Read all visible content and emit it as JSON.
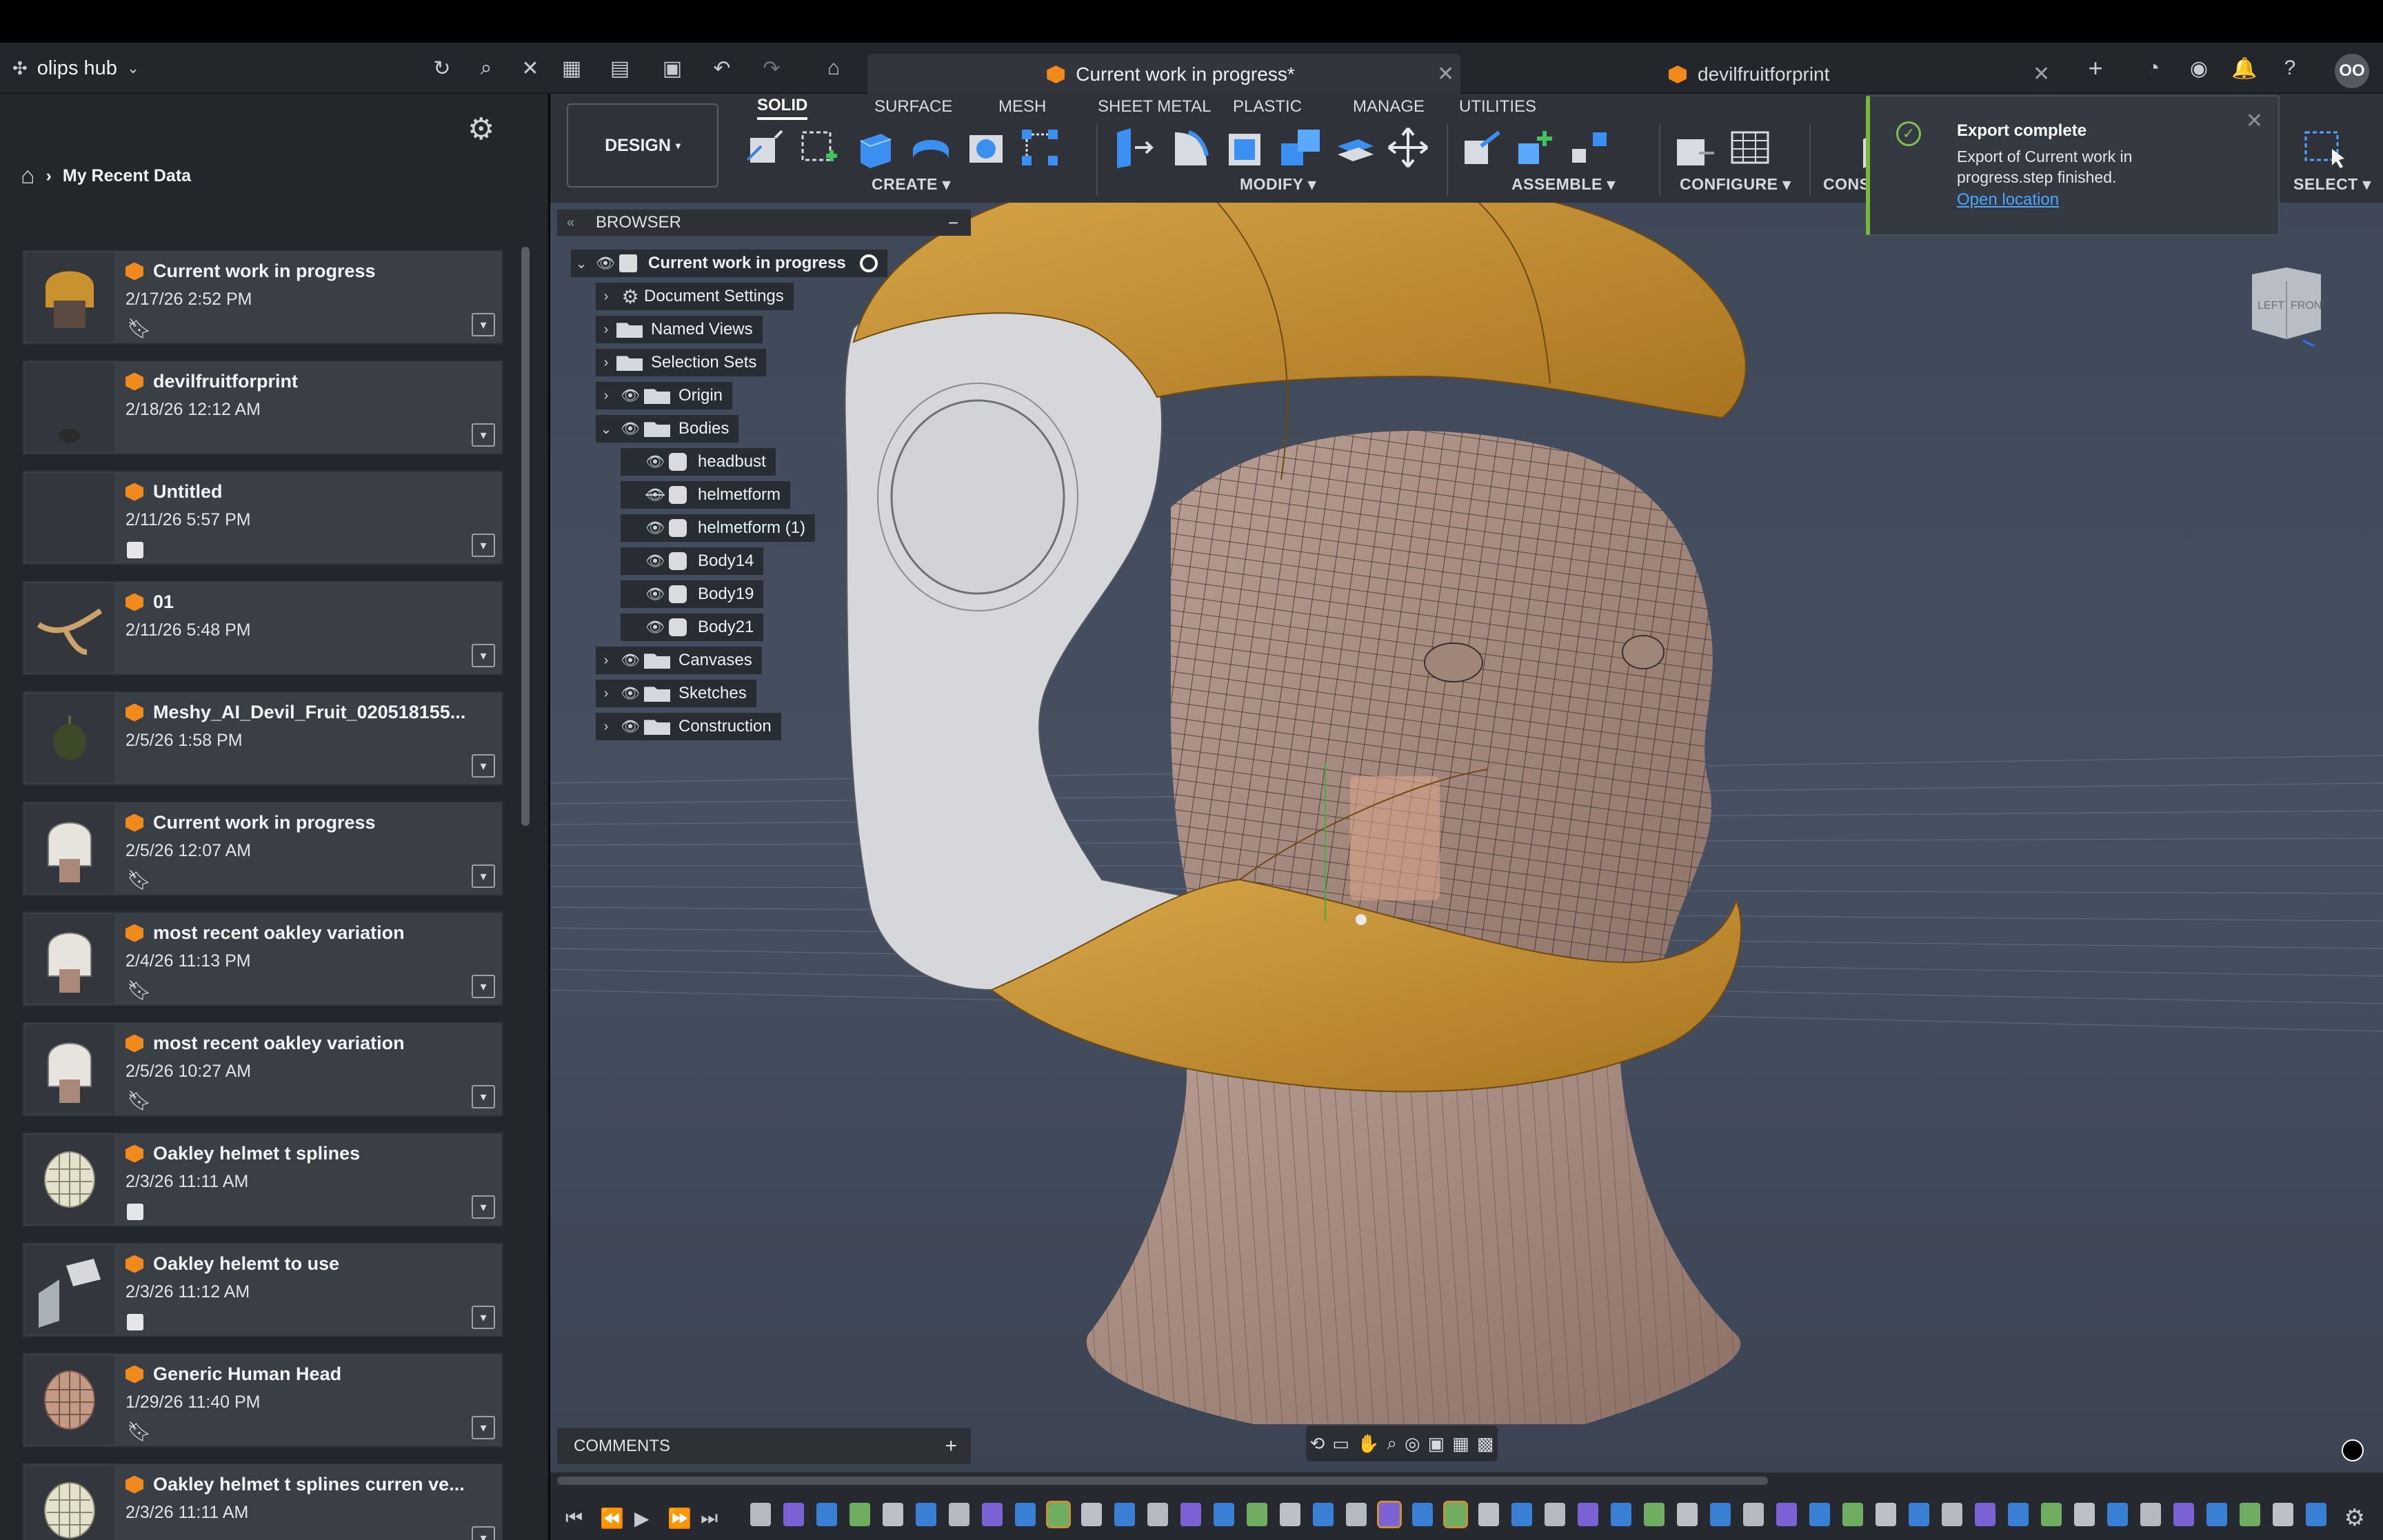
{
  "topbar": {
    "hub_name": "olips hub",
    "active_tab": "Current work in progress*",
    "other_tab": "devilfruitforprint",
    "avatar_initials": "OO"
  },
  "left_panel": {
    "breadcrumb": "My Recent Data",
    "recent_items": [
      {
        "name": "Current work in progress",
        "date": "2/17/26 2:52 PM",
        "marker": "bookmark"
      },
      {
        "name": "devilfruitforprint",
        "date": "2/18/26 12:12 AM",
        "marker": "none"
      },
      {
        "name": "Untitled",
        "date": "2/11/26 5:57 PM",
        "marker": "cube"
      },
      {
        "name": "01",
        "date": "2/11/26 5:48 PM",
        "marker": "none"
      },
      {
        "name": "Meshy_AI_Devil_Fruit_020518155...",
        "date": "2/5/26 1:58 PM",
        "marker": "none"
      },
      {
        "name": "Current work in progress",
        "date": "2/5/26 12:07 AM",
        "marker": "bookmark"
      },
      {
        "name": "most recent oakley variation",
        "date": "2/4/26 11:13 PM",
        "marker": "bookmark"
      },
      {
        "name": "most recent oakley variation",
        "date": "2/5/26 10:27 AM",
        "marker": "bookmark"
      },
      {
        "name": "Oakley helmet t splines",
        "date": "2/3/26 11:11 AM",
        "marker": "cube"
      },
      {
        "name": "Oakley helemt to use",
        "date": "2/3/26 11:12 AM",
        "marker": "cube"
      },
      {
        "name": "Generic Human Head",
        "date": "1/29/26 11:40 PM",
        "marker": "bookmark"
      },
      {
        "name": "Oakley helmet t splines curren ve...",
        "date": "2/3/26 11:11 AM",
        "marker": "none"
      }
    ]
  },
  "toolbar": {
    "workspace": "DESIGN",
    "tabs": [
      "SOLID",
      "SURFACE",
      "MESH",
      "SHEET METAL",
      "PLASTIC",
      "MANAGE",
      "UTILITIES"
    ],
    "active_tab": "SOLID",
    "groups": {
      "create": "CREATE",
      "modify": "MODIFY",
      "assemble": "ASSEMBLE",
      "configure": "CONFIGURE",
      "construct": "CONS",
      "select": "SELECT"
    }
  },
  "browser": {
    "title": "BROWSER",
    "root": "Current work in progress",
    "nodes": [
      {
        "label": "Document Settings"
      },
      {
        "label": "Named Views"
      },
      {
        "label": "Selection Sets"
      },
      {
        "label": "Origin"
      },
      {
        "label": "Bodies"
      },
      {
        "label": "headbust"
      },
      {
        "label": "helmetform"
      },
      {
        "label": "helmetform (1)"
      },
      {
        "label": "Body14"
      },
      {
        "label": "Body19"
      },
      {
        "label": "Body21"
      },
      {
        "label": "Canvases"
      },
      {
        "label": "Sketches"
      },
      {
        "label": "Construction"
      }
    ]
  },
  "notification": {
    "title": "Export complete",
    "message": "Export of Current work in progress.step finished.",
    "link": "Open location"
  },
  "viewcube": {
    "left": "LEFT",
    "front": "FRONT"
  },
  "comments": {
    "label": "COMMENTS"
  },
  "colors": {
    "accent": "#f08a1c",
    "helmet": "#c8922e",
    "success": "#7fc14b",
    "link": "#4aa6ff"
  }
}
